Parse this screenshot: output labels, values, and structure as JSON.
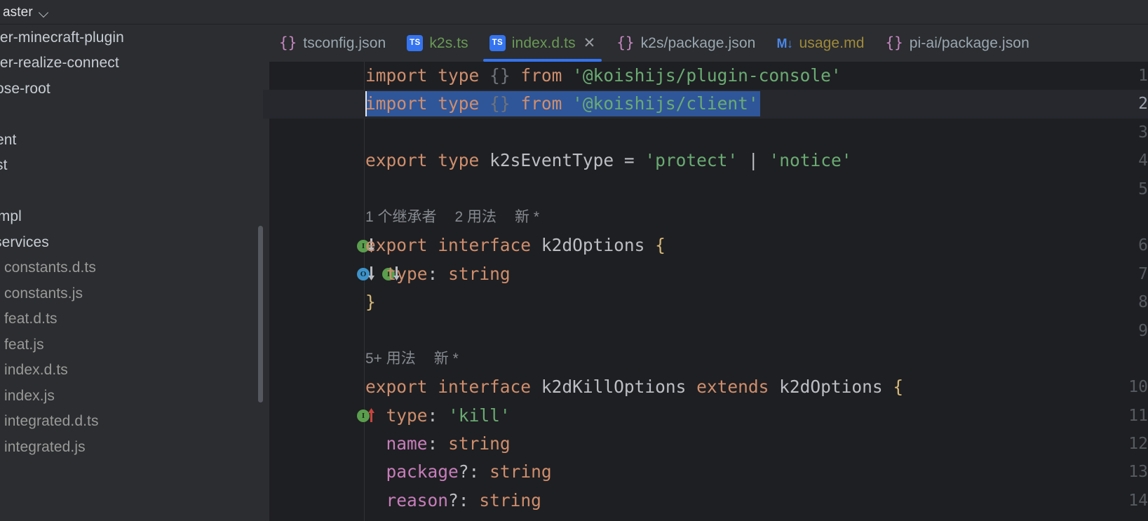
{
  "topbar": {
    "branch_label": "aster",
    "chevron_icon": "chevron-down-icon"
  },
  "sidebar": {
    "items": [
      {
        "label": "ter-minecraft-plugin",
        "kind": "directory"
      },
      {
        "label": "ter-realize-connect",
        "kind": "directory"
      },
      {
        "label": "ose-root",
        "kind": "directory"
      },
      {
        "label": "",
        "kind": "spacer"
      },
      {
        "label": "ent",
        "kind": "directory"
      },
      {
        "label": "st",
        "kind": "directory"
      },
      {
        "label": "",
        "kind": "orange-sliver"
      },
      {
        "label": "impl",
        "kind": "directory"
      },
      {
        "label": "services",
        "kind": "directory"
      },
      {
        "label": "constants.d.ts",
        "kind": "file"
      },
      {
        "label": "constants.js",
        "kind": "file"
      },
      {
        "label": "feat.d.ts",
        "kind": "file"
      },
      {
        "label": "feat.js",
        "kind": "file"
      },
      {
        "label": "index.d.ts",
        "kind": "file"
      },
      {
        "label": "index.js",
        "kind": "file"
      },
      {
        "label": "integrated.d.ts",
        "kind": "file"
      },
      {
        "label": "integrated.js",
        "kind": "file"
      }
    ]
  },
  "tabs": [
    {
      "label": "tsconfig.json",
      "icon": "json-braces-icon",
      "type": "json",
      "active": false,
      "closable": false
    },
    {
      "label": "k2s.ts",
      "icon": "typescript-icon",
      "type": "ts",
      "active": false,
      "closable": false
    },
    {
      "label": "index.d.ts",
      "icon": "typescript-icon",
      "type": "ts",
      "active": true,
      "closable": true
    },
    {
      "label": "k2s/package.json",
      "icon": "json-braces-icon",
      "type": "json",
      "active": false,
      "closable": false
    },
    {
      "label": "usage.md",
      "icon": "markdown-icon",
      "type": "md",
      "active": false,
      "closable": false
    },
    {
      "label": "pi-ai/package.json",
      "icon": "json-braces-icon",
      "type": "json",
      "active": false,
      "closable": false
    }
  ],
  "tab_icon_glyphs": {
    "json": "{}",
    "ts": "TS",
    "md": "M↓",
    "close": "✕"
  },
  "editor": {
    "language": "typescript",
    "selected_line": 2,
    "selection_text": "import type {} from '@koishijs/client'",
    "lines": [
      {
        "n": "1",
        "text": "import type {} from '@koishijs/plugin-console'"
      },
      {
        "n": "2",
        "text": "import type {} from '@koishijs/client'"
      },
      {
        "n": "3",
        "text": ""
      },
      {
        "n": "4",
        "text": "export type k2sEventType = 'protect' | 'notice'"
      },
      {
        "n": "5",
        "text": ""
      },
      {
        "n": "6",
        "text": "export interface k2dOptions {"
      },
      {
        "n": "7",
        "text": "  type: string"
      },
      {
        "n": "8",
        "text": "}"
      },
      {
        "n": "9",
        "text": ""
      },
      {
        "n": "10",
        "text": "export interface k2dKillOptions extends k2dOptions {"
      },
      {
        "n": "11",
        "text": "  type: 'kill'"
      },
      {
        "n": "12",
        "text": "  name: string"
      },
      {
        "n": "13",
        "text": "  package?: string"
      },
      {
        "n": "14",
        "text": "  reason?: string"
      }
    ],
    "codelens": [
      {
        "above_line": "6",
        "inheritors": "1 个继承者",
        "usages": "2 用法",
        "new": "新 *"
      },
      {
        "above_line": "10",
        "inheritors": "",
        "usages": "5+ 用法",
        "new": "新 *"
      }
    ],
    "gutter_markers": [
      {
        "line": "6",
        "icons": [
          "implemented-down-icon"
        ]
      },
      {
        "line": "7",
        "icons": [
          "overridden-down-icon",
          "implemented-down-icon"
        ]
      },
      {
        "line": "11",
        "icons": [
          "overriding-up-icon"
        ]
      }
    ]
  },
  "colors": {
    "accent_blue": "#3574f0",
    "selection_blue": "#2f5699",
    "editor_bg": "#1e1f22",
    "chrome_bg": "#2b2d30",
    "keyword": "#cf8e6d",
    "string": "#6aab73",
    "property": "#c77dbb",
    "brace": "#d5b778",
    "ts_green": "#6a9955",
    "marker_green": "#5a9e4e",
    "marker_blue": "#3d93c9",
    "marker_red": "#c9443f"
  }
}
